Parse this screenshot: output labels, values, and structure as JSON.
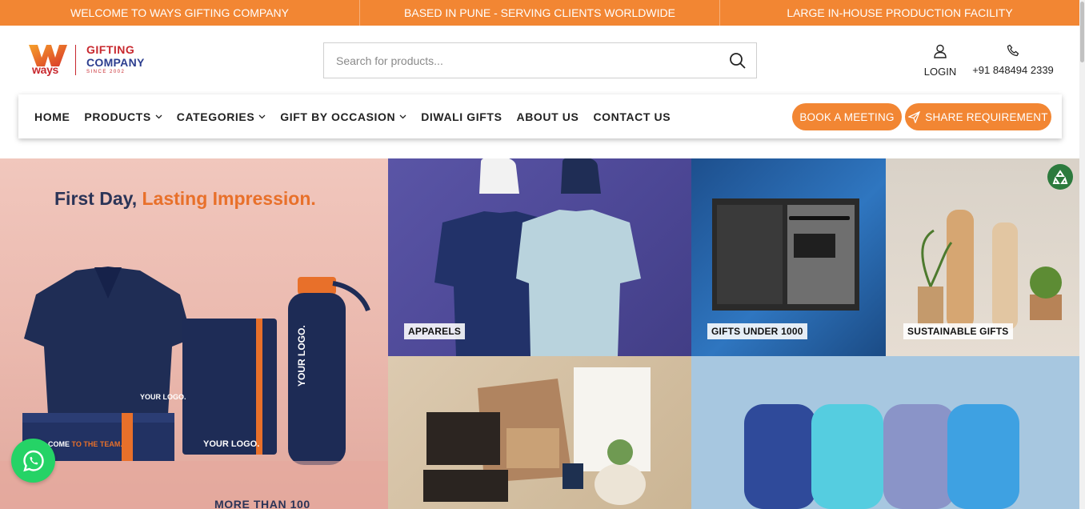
{
  "topbar": {
    "items": [
      "WELCOME TO WAYS GIFTING COMPANY",
      "BASED IN PUNE - SERVING CLIENTS WORLDWIDE",
      "LARGE IN-HOUSE PRODUCTION FACILITY"
    ]
  },
  "logo": {
    "mark": "ways",
    "line1": "GIFTING",
    "line2": "COMPANY",
    "line3": "SINCE 2002"
  },
  "search": {
    "placeholder": "Search for products...",
    "value": "",
    "icon": "search-icon"
  },
  "account": {
    "login_label": "LOGIN",
    "login_icon": "user-icon"
  },
  "contact": {
    "phone": "+91 848494 2339",
    "icon": "phone-icon"
  },
  "nav": {
    "items": [
      {
        "label": "HOME",
        "dropdown": false
      },
      {
        "label": "PRODUCTS",
        "dropdown": true
      },
      {
        "label": "CATEGORIES",
        "dropdown": true
      },
      {
        "label": "GIFT BY OCCASION",
        "dropdown": true
      },
      {
        "label": "DIWALI GIFTS",
        "dropdown": false
      },
      {
        "label": "ABOUT US",
        "dropdown": false
      },
      {
        "label": "CONTACT US",
        "dropdown": false
      }
    ],
    "book_meeting": "BOOK A MEETING",
    "share_requirement": "SHARE REQUIREMENT",
    "share_icon": "paper-plane-icon"
  },
  "hero": {
    "headline_part1": "First Day, ",
    "headline_part2": "Lasting Impression.",
    "shirt_text": "YOUR LOGO.",
    "notebook_text": "YOUR LOGO.",
    "bottle_text": "YOUR LOGO.",
    "box_text_part1": "COME ",
    "box_text_part2": "TO THE TEAM.",
    "bottom_text": "MORE THAN 100"
  },
  "tiles": [
    {
      "label": "APPARELS"
    },
    {
      "label": "GIFTS UNDER 1000"
    },
    {
      "label": "SUSTAINABLE GIFTS"
    }
  ],
  "colors": {
    "brand_orange": "#f28633",
    "brand_red": "#c8282e",
    "brand_navy": "#2c3e8f",
    "whatsapp_green": "#25d366"
  },
  "floating": {
    "whatsapp_icon": "whatsapp-icon",
    "recycle_icon": "recycle-icon"
  }
}
